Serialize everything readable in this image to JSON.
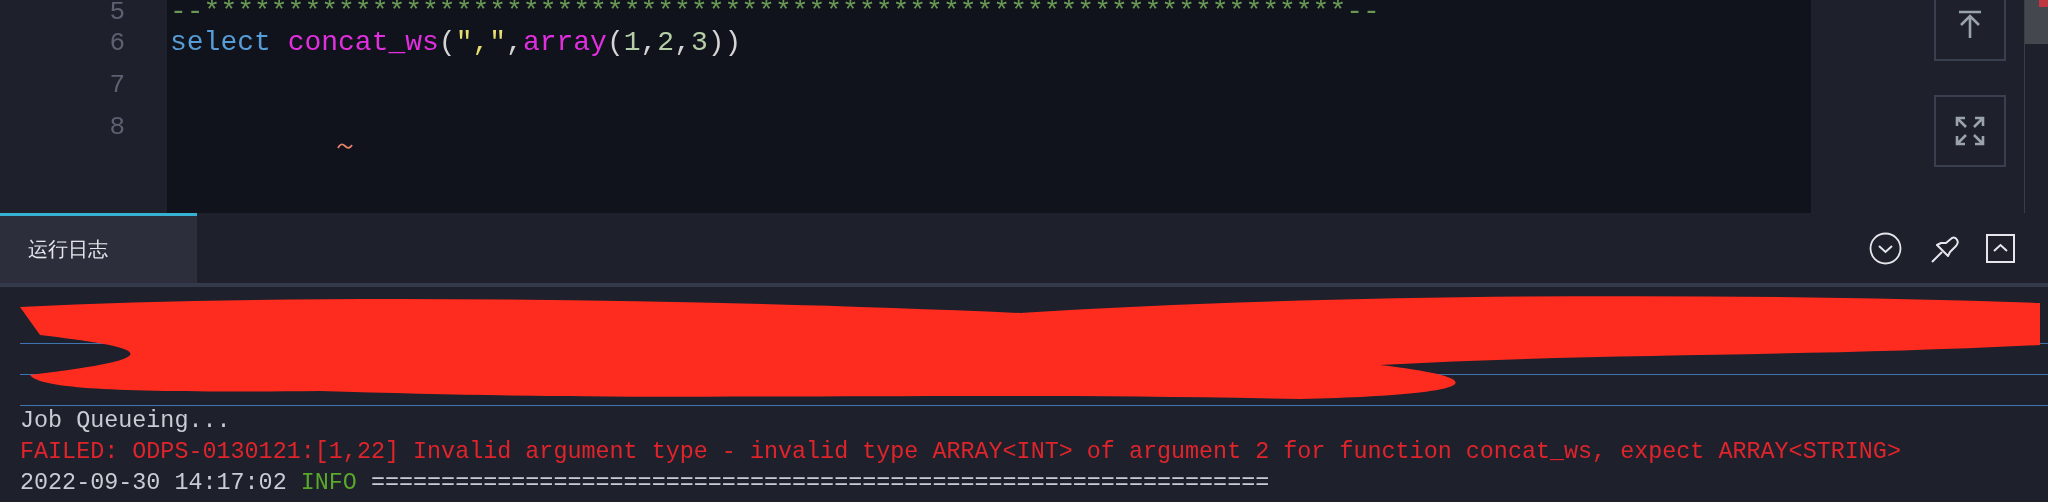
{
  "editor": {
    "lines": [
      {
        "number": "5",
        "tokens": [
          {
            "text": "--********************************************************************--",
            "kind": "comment"
          }
        ]
      },
      {
        "number": "6",
        "tokens": [
          {
            "text": "select",
            "kind": "keyword"
          },
          {
            "text": "concat_ws",
            "kind": "function"
          },
          {
            "text": "(",
            "kind": "punct"
          },
          {
            "text": "\",\"",
            "kind": "string"
          },
          {
            "text": ",",
            "kind": "punct"
          },
          {
            "text": "array",
            "kind": "function"
          },
          {
            "text": "(",
            "kind": "punct"
          },
          {
            "text": "1",
            "kind": "number"
          },
          {
            "text": ",",
            "kind": "punct"
          },
          {
            "text": "2",
            "kind": "number"
          },
          {
            "text": ",",
            "kind": "punct"
          },
          {
            "text": "3",
            "kind": "number"
          },
          {
            "text": "))",
            "kind": "punct"
          }
        ]
      },
      {
        "number": "7"
      },
      {
        "number": "8"
      }
    ]
  },
  "panel": {
    "tabs": [
      {
        "label": "运行日志",
        "selected": true
      }
    ]
  },
  "log": {
    "lines": [
      {
        "parts": [
          {
            "text": "Job Queueing...",
            "kind": "plain"
          }
        ]
      },
      {
        "parts": [
          {
            "text": "FAILED: ODPS-0130121:[1,22] Invalid argument type - invalid type ARRAY<INT> of argument 2 for function concat_ws, expect ARRAY<STRING>",
            "kind": "error"
          }
        ]
      },
      {
        "parts": [
          {
            "text": "2022-09-30 14:17:02",
            "kind": "plain"
          },
          {
            "text": "INFO",
            "kind": "info"
          },
          {
            "text": "================================================================",
            "kind": "plain"
          }
        ]
      }
    ]
  }
}
